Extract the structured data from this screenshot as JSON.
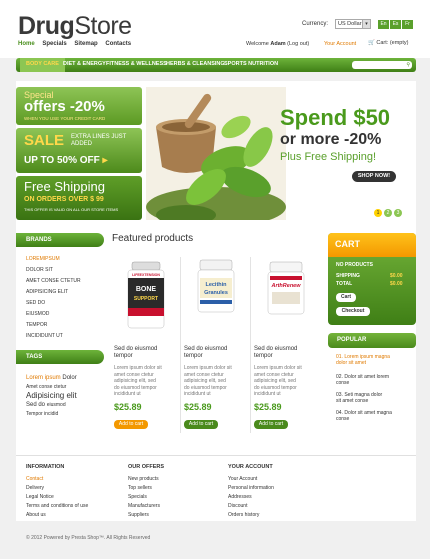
{
  "header": {
    "logo_part1": "Drug",
    "logo_part2": "Store",
    "nav": [
      "Home",
      "Specials",
      "Sitemap",
      "Contacts"
    ],
    "currency_label": "Currency:",
    "currency_value": "US Dollar",
    "languages": [
      "En",
      "Es",
      "Fr"
    ],
    "welcome_prefix": "Welcome",
    "welcome_user": "Adam",
    "logout": "(Log out)",
    "your_account": "Your Account",
    "cart_link": "Cart: (empty)"
  },
  "menu": [
    "BODY CARE",
    "DIET & ENERGY",
    "FITNESS & WELLNESS",
    "HERBS & CLEANSING",
    "SPORTS NUTRITION"
  ],
  "promo": {
    "special": "Special",
    "offers": "offers -20%",
    "card_note": "WHEN YOU USE YOUR CREDIT CARD",
    "sale": "SALE",
    "extra": "EXTRA LINES JUST",
    "added": "ADDED",
    "upto": "UP TO 50% OFF",
    "arrow": "▸",
    "free": "Free Shipping",
    "orders": "ON ORDERS OVER $ 99",
    "valid": "THIS OFFER IS VALID ON ALL OUR STORE ITEMS"
  },
  "banner": {
    "line1": "Spend $50",
    "line2": "or more -20%",
    "line3": "Plus Free Shipping!",
    "button": "SHOP NOW!",
    "pages": [
      "1",
      "2",
      "3"
    ]
  },
  "brands": {
    "title": "BRANDS",
    "items": [
      "LOREMIPSUM",
      "DOLOR SIT",
      "AMET CONSE CTETUR",
      "ADIPISICING ELIT",
      "SED DO",
      "EIUSMOD",
      "TEMPOR",
      "INCIDIDUNT UT"
    ]
  },
  "tags": {
    "title": "TAGS",
    "items": [
      "Lorem ipsum",
      "Dolor",
      "Amet conse ctetur",
      "Adipisicing elit",
      "Sed do",
      "eiusmod",
      "Tempor incidid"
    ]
  },
  "featured": {
    "title": "Featured products",
    "products": [
      {
        "name_line1": "Sed do eiusmod",
        "name_line2": "tempor",
        "desc": [
          "Lorem ipsum dolor sit",
          "amet conse ctetur",
          "adipisicing elit, sed",
          "do eiusmod tempor",
          "incididunt ut"
        ],
        "price": "$25.89",
        "button": "Add to cart",
        "label_top": "LIFEEXTENSION",
        "label_main": "BONE",
        "label_sub": "SUPPORT"
      },
      {
        "name_line1": "Sed do eiusmod",
        "name_line2": "tempor",
        "desc": [
          "Lorem ipsum dolor sit",
          "amet conse ctetur",
          "adipisicing elit, sed",
          "do eiusmod tempor",
          "incididunt ut"
        ],
        "price": "$25.89",
        "button": "Add to cart",
        "label_main": "Lecithin",
        "label_sub": "Granules"
      },
      {
        "name_line1": "Sed do eiusmod",
        "name_line2": "tempor",
        "desc": [
          "Lorem ipsum dolor sit",
          "amet conse ctetur",
          "adipisicing elit, sed",
          "do eiusmod tempor",
          "incididunt ut"
        ],
        "price": "$25.89",
        "button": "Add to cart",
        "label_main": "ArthRenew"
      }
    ]
  },
  "cart": {
    "title": "CART",
    "no_products": "NO PRODUCTS",
    "shipping_label": "SHIPPING",
    "shipping_value": "$0.00",
    "total_label": "TOTAL",
    "total_value": "$0.00",
    "cart_button": "Cart",
    "checkout_button": "Checkout"
  },
  "popular": {
    "title": "POPULAR",
    "items": [
      [
        "01. Lorem ipsum magna",
        "dolor sit amet"
      ],
      [
        "02. Dolor sit amet lorem",
        "conse"
      ],
      [
        "03. Seti magna dolor",
        "sit amet conse"
      ],
      [
        "04. Dolor sit amet magna",
        "conse"
      ]
    ]
  },
  "footer": {
    "col1_title": "INFORMATION",
    "col1": [
      "Contact",
      "Delivery",
      "Legal Notice",
      "Terms and conditions of use",
      "About us"
    ],
    "col2_title": "OUR OFFERS",
    "col2": [
      "New products",
      "Top sellers",
      "Specials",
      "Manufacturers",
      "Suppliers"
    ],
    "col3_title": "YOUR ACCOUNT",
    "col3": [
      "Your Account",
      "Personal information",
      "Addresses",
      "Discount",
      "Orders history"
    ],
    "copyright": "© 2012 Powered by Presta Shop™. All Rights Reserved"
  },
  "colors": {
    "accent_green": "#5aa02c",
    "accent_orange": "#e07a00",
    "cart_orange": "#f39800"
  }
}
